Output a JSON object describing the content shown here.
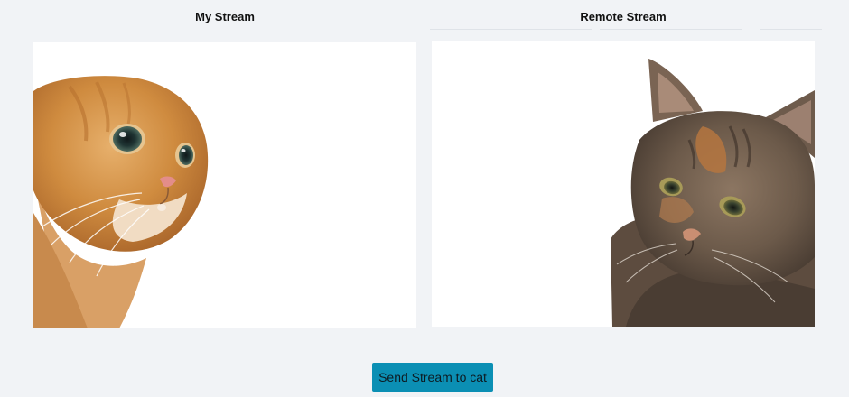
{
  "streams": {
    "local": {
      "title": "My Stream",
      "video_content": "surprised-orange-cat"
    },
    "remote": {
      "title": "Remote Stream",
      "video_content": "sad-tabby-cat"
    }
  },
  "actions": {
    "send_label": "Send Stream to cat"
  },
  "colors": {
    "page_background": "#f1f3f6",
    "video_background": "#ffffff",
    "button_background": "#0b8fb4",
    "button_text": "#0d1b22"
  }
}
